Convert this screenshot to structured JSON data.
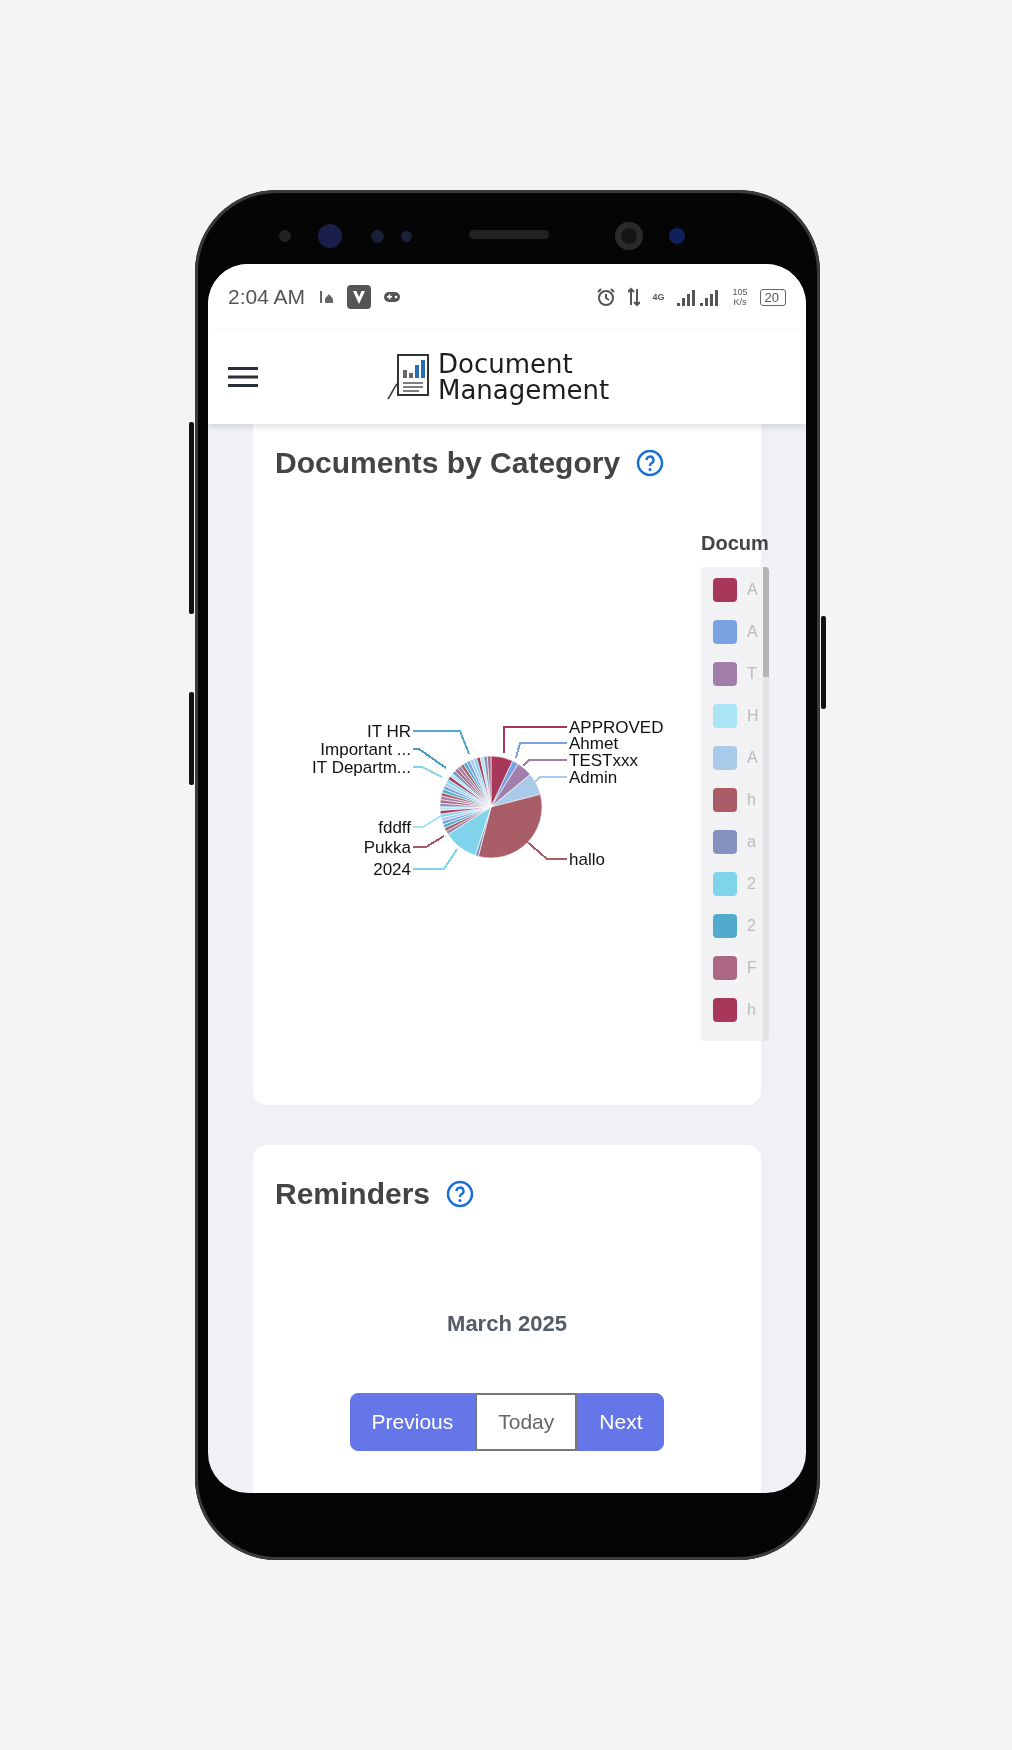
{
  "status_bar": {
    "time": "2:04 AM",
    "network": "4G",
    "speed_value": "105",
    "speed_unit": "K/s",
    "battery": "20"
  },
  "header": {
    "logo_lines": [
      "Document",
      "Management"
    ]
  },
  "category_card": {
    "title": "Documents by Category",
    "pie_labels": [
      {
        "label": "APPROVED",
        "color": "#a8385a"
      },
      {
        "label": "Ahmet",
        "color": "#7ba2e0"
      },
      {
        "label": "TESTxxx",
        "color": "#a27fab"
      },
      {
        "label": "Admin",
        "color": "#a9cbe9"
      },
      {
        "label": "hallo",
        "color": "#a95d67"
      },
      {
        "label": "IT HR",
        "color": "#52abcc"
      },
      {
        "label": "Important ...",
        "color": "#4a9cc0"
      },
      {
        "label": "IT Departm...",
        "color": "#7fd4ec"
      },
      {
        "label": "fddff",
        "color": "#abe4f5"
      },
      {
        "label": "Pukka",
        "color": "#a8566a"
      },
      {
        "label": "2024",
        "color": "#7fd4ec"
      }
    ],
    "legend": {
      "title": "Docum",
      "items": [
        {
          "label": "A",
          "color": "#a8385a"
        },
        {
          "label": "A",
          "color": "#7ba2e0"
        },
        {
          "label": "T",
          "color": "#a27fab"
        },
        {
          "label": "H",
          "color": "#abe4f5"
        },
        {
          "label": "A",
          "color": "#a9cbe9"
        },
        {
          "label": "h",
          "color": "#a95d67"
        },
        {
          "label": "a",
          "color": "#8392c0"
        },
        {
          "label": "2",
          "color": "#7fd4ec"
        },
        {
          "label": "2",
          "color": "#52abcc"
        },
        {
          "label": "F",
          "color": "#ab6783"
        },
        {
          "label": "h",
          "color": "#a8385a"
        }
      ]
    }
  },
  "reminders_card": {
    "title": "Reminders",
    "month": "March 2025",
    "buttons": [
      {
        "label": "Previous",
        "selected": false
      },
      {
        "label": "Today",
        "selected": true
      },
      {
        "label": "Next",
        "selected": false
      }
    ]
  }
}
